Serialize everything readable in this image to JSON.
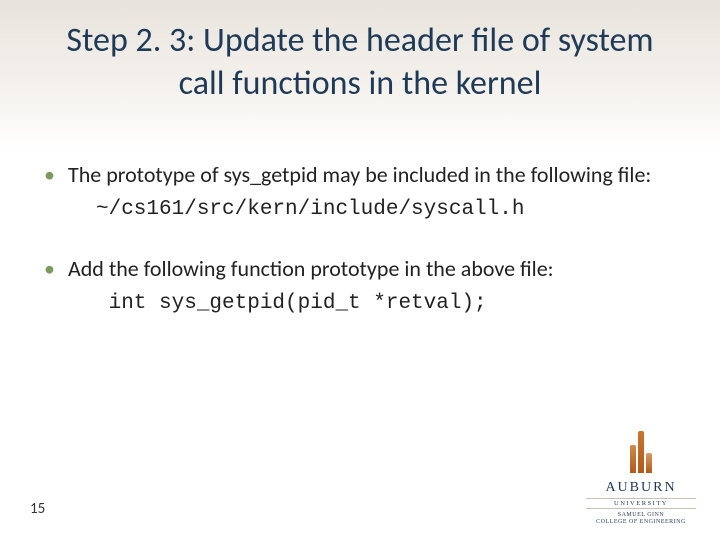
{
  "title": "Step 2. 3: Update the header file of system call functions in the kernel",
  "bullets": [
    {
      "text": "The prototype of sys_getpid may be included in the following file:",
      "code": "~/cs161/src/kern/include/syscall.h"
    },
    {
      "text": "Add the following function prototype in the above file:",
      "code": " int sys_getpid(pid_t *retval);"
    }
  ],
  "page_number": "15",
  "logo": {
    "name": "AUBURN",
    "sub": "UNIVERSITY",
    "college_line1": "SAMUEL GINN",
    "college_line2": "COLLEGE OF ENGINEERING"
  }
}
